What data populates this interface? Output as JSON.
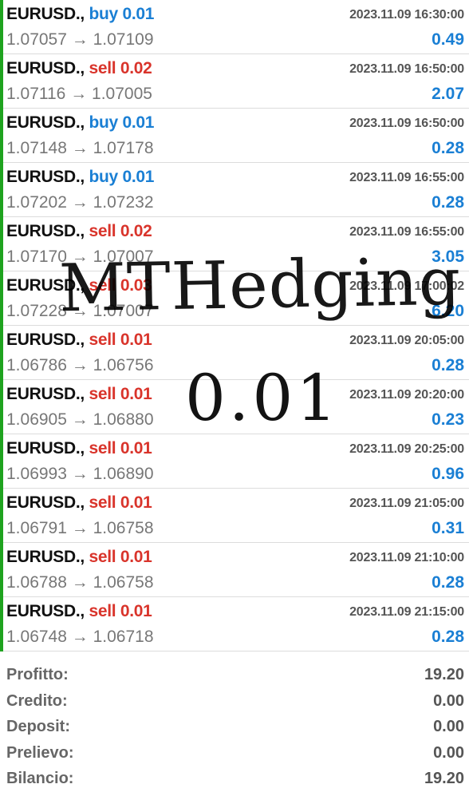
{
  "trades": [
    {
      "symbol": "EURUSD.,",
      "side": "buy",
      "volume": "0.01",
      "open_price": "1.07057",
      "close_price": "1.07109",
      "time": "2023.11.09 16:30:00",
      "profit": "0.49"
    },
    {
      "symbol": "EURUSD.,",
      "side": "sell",
      "volume": "0.02",
      "open_price": "1.07116",
      "close_price": "1.07005",
      "time": "2023.11.09 16:50:00",
      "profit": "2.07"
    },
    {
      "symbol": "EURUSD.,",
      "side": "buy",
      "volume": "0.01",
      "open_price": "1.07148",
      "close_price": "1.07178",
      "time": "2023.11.09 16:50:00",
      "profit": "0.28"
    },
    {
      "symbol": "EURUSD.,",
      "side": "buy",
      "volume": "0.01",
      "open_price": "1.07202",
      "close_price": "1.07232",
      "time": "2023.11.09 16:55:00",
      "profit": "0.28"
    },
    {
      "symbol": "EURUSD.,",
      "side": "sell",
      "volume": "0.02",
      "open_price": "1.07170",
      "close_price": "1.07007",
      "time": "2023.11.09 16:55:00",
      "profit": "3.05"
    },
    {
      "symbol": "EURUSD.,",
      "side": "sell",
      "volume": "0.03",
      "open_price": "1.07228",
      "close_price": "1.07007",
      "time": "2023.11.09 17:00:02",
      "profit": "6.20"
    },
    {
      "symbol": "EURUSD.,",
      "side": "sell",
      "volume": "0.01",
      "open_price": "1.06786",
      "close_price": "1.06756",
      "time": "2023.11.09 20:05:00",
      "profit": "0.28"
    },
    {
      "symbol": "EURUSD.,",
      "side": "sell",
      "volume": "0.01",
      "open_price": "1.06905",
      "close_price": "1.06880",
      "time": "2023.11.09 20:20:00",
      "profit": "0.23"
    },
    {
      "symbol": "EURUSD.,",
      "side": "sell",
      "volume": "0.01",
      "open_price": "1.06993",
      "close_price": "1.06890",
      "time": "2023.11.09 20:25:00",
      "profit": "0.96"
    },
    {
      "symbol": "EURUSD.,",
      "side": "sell",
      "volume": "0.01",
      "open_price": "1.06791",
      "close_price": "1.06758",
      "time": "2023.11.09 21:05:00",
      "profit": "0.31"
    },
    {
      "symbol": "EURUSD.,",
      "side": "sell",
      "volume": "0.01",
      "open_price": "1.06788",
      "close_price": "1.06758",
      "time": "2023.11.09 21:10:00",
      "profit": "0.28"
    },
    {
      "symbol": "EURUSD.,",
      "side": "sell",
      "volume": "0.01",
      "open_price": "1.06748",
      "close_price": "1.06718",
      "time": "2023.11.09 21:15:00",
      "profit": "0.28"
    }
  ],
  "arrow": "→",
  "summary": [
    {
      "label": "Profitto:",
      "value": "19.20"
    },
    {
      "label": "Credito:",
      "value": "0.00"
    },
    {
      "label": "Deposit:",
      "value": "0.00"
    },
    {
      "label": "Prelievo:",
      "value": "0.00"
    },
    {
      "label": "Bilancio:",
      "value": "19.20"
    }
  ],
  "watermark": {
    "title": "MTHedging",
    "version": "0.01"
  },
  "colors": {
    "buy": "#1a7fd4",
    "sell": "#d9342b",
    "profit": "#1a7fd4",
    "row_bar": "#1fa31f"
  }
}
